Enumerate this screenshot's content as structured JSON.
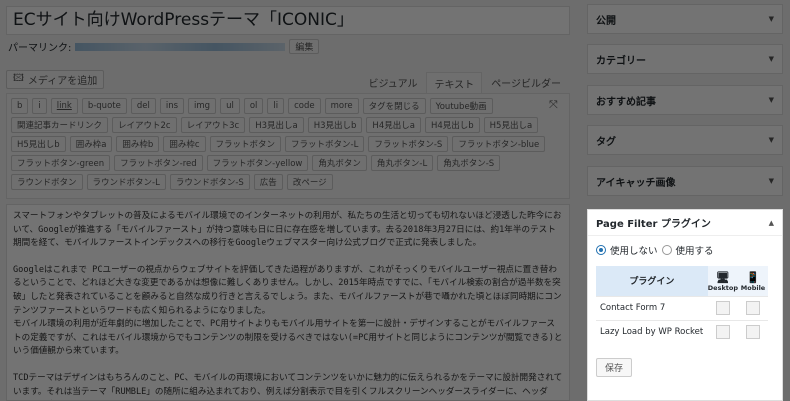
{
  "editor": {
    "title": "ECサイト向けWordPressテーマ「ICONIC」",
    "permalink_label": "パーマリンク:",
    "edit_label": "編集",
    "media_label": "メディアを追加",
    "tabs": [
      "ビジュアル",
      "テキスト",
      "ページビルダー"
    ],
    "toolbar_buttons": [
      "b",
      "i",
      "link",
      "b-quote",
      "del",
      "ins",
      "img",
      "ul",
      "ol",
      "li",
      "code",
      "more",
      "タグを閉じる",
      "Youtube動画",
      "関連記事カードリンク",
      "レイアウト2c",
      "レイアウト3c",
      "H3見出しa",
      "H3見出しb",
      "H4見出しa",
      "H4見出しb",
      "H5見出しa",
      "H5見出しb",
      "囲み枠a",
      "囲み枠b",
      "囲み枠c",
      "フラットボタン",
      "フラットボタン-L",
      "フラットボタン-S",
      "フラットボタン-blue",
      "フラットボタン-green",
      "フラットボタン-red",
      "フラットボタン-yellow",
      "角丸ボタン",
      "角丸ボタン-L",
      "角丸ボタン-S",
      "ラウンドボタン",
      "ラウンドボタン-L",
      "ラウンドボタン-S",
      "広告",
      "改ページ"
    ],
    "paragraphs": [
      "スマートフォンやタブレットの普及によるモバイル環境でのインターネットの利用が、私たちの生活と切っても切れないほど浸透した昨今において、Googleが推進する「モバイルファースト」が持つ意味も日に日に存在感を増しています。去る2018年3月27日には、約1年半のテスト期間を経て、モバイルファーストインデックスへの移行をGoogleウェブマスター向け公式ブログで正式に発表しました。",
      "Googleはこれまで PCユーザーの視点からウェブサイトを評価してきた過程がありますが、これがそっくりモバイルユーザー視点に置き替わるということで、どれほど大きな変更であるかは想像に難しくありません。しかし、2015年時点ですでに、「モバイル検索の割合が過半数を突破」したと発表されていることを顧みると自然な成り行きと言えるでしょう。また、モバイルファーストが巷で囁かれた頃とほぼ同時期にコンテンツファーストというワードも広く知られるようになりました。\nモバイル環境の利用が近年劇的に増加したことで、PC用サイトよりもモバイル用サイトを第一に設計・デザインすることがモバイルファーストの定義ですが、これはモバイル環境からでもコンテンツの制限を受けるべきではない(=PC用サイトと同じようにコンテンツが閲覧できる)という価値観から来ています。",
      "TCDテーマはデザインはもちろんのこと、PC、モバイルの両環境においてコンテンツをいかに魅力的に伝えられるかをテーマに設計開発されています。それは当テーマ「RUMBLE」の随所に組み込まれており、例えば分割表示で目を引くフルスクリーンヘッダースライダーに、ヘッダー・フッターカ"
    ]
  },
  "sidebar": {
    "panels": [
      {
        "label": "公開"
      },
      {
        "label": "カテゴリー"
      },
      {
        "label": "おすすめ記事"
      },
      {
        "label": "タグ"
      },
      {
        "label": "アイキャッチ画像"
      }
    ],
    "page_filter": {
      "title": "Page Filter プラグイン",
      "radio_off": "使用しない",
      "radio_on": "使用する",
      "col_plugin": "プラグイン",
      "col_desktop": "Desktop",
      "col_mobile": "Mobile",
      "rows": [
        {
          "name": "Contact Form 7"
        },
        {
          "name": "Lazy Load by WP Rocket"
        }
      ],
      "save_label": "保存"
    }
  }
}
